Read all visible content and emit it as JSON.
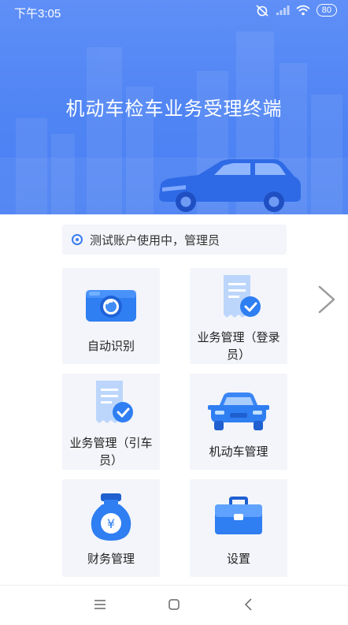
{
  "status_bar": {
    "time": "下午3:05",
    "battery": "80",
    "icons": [
      "alarm-off-icon",
      "signal-icon",
      "wifi-icon",
      "battery-icon"
    ]
  },
  "header": {
    "title": "机动车检车业务受理终端"
  },
  "account": {
    "text": "测试账户使用中，管理员"
  },
  "tiles": [
    {
      "label": "自动识别",
      "icon": "camera-icon"
    },
    {
      "label": "业务管理（登录员）",
      "icon": "receipt-check-icon"
    },
    {
      "label": "业务管理（引车员）",
      "icon": "receipt-check-icon"
    },
    {
      "label": "机动车管理",
      "icon": "car-icon"
    },
    {
      "label": "财务管理",
      "icon": "money-bag-icon"
    },
    {
      "label": "设置",
      "icon": "briefcase-icon"
    }
  ],
  "colors": {
    "header": "#4f84f4",
    "accent": "#3a7cf0",
    "tile_bg": "#f3f5fa"
  }
}
